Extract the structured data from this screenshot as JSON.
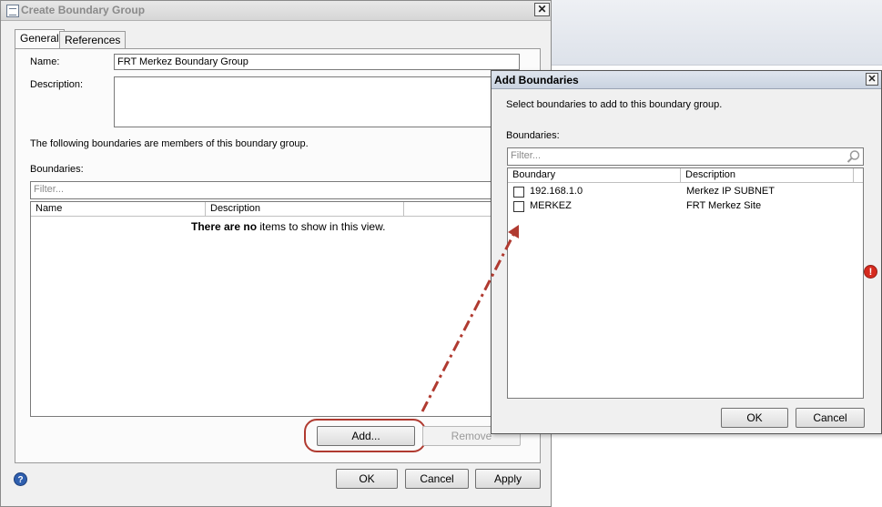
{
  "main_dialog": {
    "title": "Create Boundary Group",
    "close_glyph": "✕",
    "tabs": [
      {
        "label": "General"
      },
      {
        "label": "References"
      }
    ],
    "name_label": "Name:",
    "name_value": "FRT Merkez Boundary Group",
    "description_label": "Description:",
    "description_value": "",
    "members_text": "The following boundaries are members of this boundary group.",
    "boundaries_label": "Boundaries:",
    "filter_placeholder": "Filter...",
    "columns": [
      "Name",
      "Description"
    ],
    "empty_text_bold": "There are no",
    "empty_text_rest": " items to show in this view.",
    "add_button": "Add...",
    "remove_button": "Remove",
    "ok_button": "OK",
    "cancel_button": "Cancel",
    "apply_button": "Apply",
    "help_glyph": "?"
  },
  "add_dialog": {
    "title": "Add Boundaries",
    "close_glyph": "✕",
    "instruction": "Select boundaries to add to this boundary group.",
    "boundaries_label": "Boundaries:",
    "filter_placeholder": "Filter...",
    "search_icon": "magnifier-icon",
    "columns": [
      "Boundary",
      "Description"
    ],
    "rows": [
      {
        "boundary": "192.168.1.0",
        "description": "Merkez IP SUBNET",
        "checked": false
      },
      {
        "boundary": "MERKEZ",
        "description": "FRT Merkez Site",
        "checked": false
      }
    ],
    "ok_button": "OK",
    "cancel_button": "Cancel"
  },
  "annotation": {
    "arrow_color": "#b03a30",
    "highlight_color": "#b03a30"
  },
  "error_glyph": "!"
}
